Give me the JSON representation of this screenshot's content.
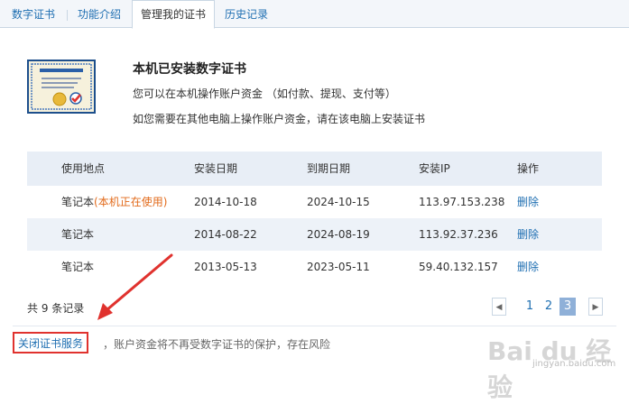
{
  "tabs": [
    {
      "label": "数字证书"
    },
    {
      "label": "功能介绍"
    },
    {
      "label": "管理我的证书"
    },
    {
      "label": "历史记录"
    }
  ],
  "header": {
    "title": "本机已安装数字证书",
    "line1": "您可以在本机操作账户资金 （如付款、提现、支付等）",
    "line2": "如您需要在其他电脑上操作账户资金，请在该电脑上安装证书",
    "image_icon": "certificate-icon"
  },
  "table": {
    "columns": [
      "使用地点",
      "安装日期",
      "到期日期",
      "安装IP",
      "操作"
    ],
    "rows": [
      {
        "location": "笔记本",
        "note": "(本机正在使用)",
        "install_date": "2014-10-18",
        "expire_date": "2024-10-15",
        "ip": "113.97.153.238",
        "action": "删除"
      },
      {
        "location": "笔记本",
        "note": "",
        "install_date": "2014-08-22",
        "expire_date": "2024-08-19",
        "ip": "113.92.37.236",
        "action": "删除"
      },
      {
        "location": "笔记本",
        "note": "",
        "install_date": "2013-05-13",
        "expire_date": "2023-05-11",
        "ip": "59.40.132.157",
        "action": "删除"
      }
    ]
  },
  "footer": {
    "total": "共 9 条记录",
    "pages": [
      "1",
      "2",
      "3"
    ],
    "current_page": "3",
    "close_service": "关闭证书服务",
    "warning": "，账户资金将不再受数字证书的保护，存在风险"
  },
  "watermark": {
    "logo": "Bai du 经验",
    "url": "jingyan.baidu.com"
  },
  "colors": {
    "link": "#1f6fb2",
    "in_use": "#e26a1a",
    "highlight_border": "#e0322e",
    "arrow": "#e0322e",
    "table_header_bg": "#e8eef6",
    "current_page_bg": "#8fb0d8"
  }
}
